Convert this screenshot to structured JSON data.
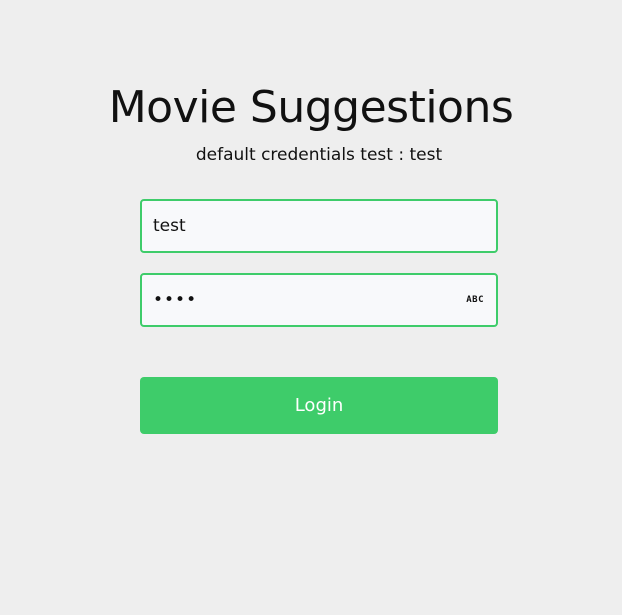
{
  "header": {
    "title": "Movie Suggestions",
    "subtitle": "default credentials test : test"
  },
  "form": {
    "username": {
      "value": "test"
    },
    "password": {
      "value": "test",
      "reveal_label": "ABC",
      "reveal_icon": "show-password-icon"
    },
    "login_label": "Login"
  },
  "colors": {
    "accent": "#3ecc6a",
    "background": "#eeeeee",
    "field_background": "#f8f9fb",
    "text": "#111111",
    "button_text": "#ffffff"
  }
}
